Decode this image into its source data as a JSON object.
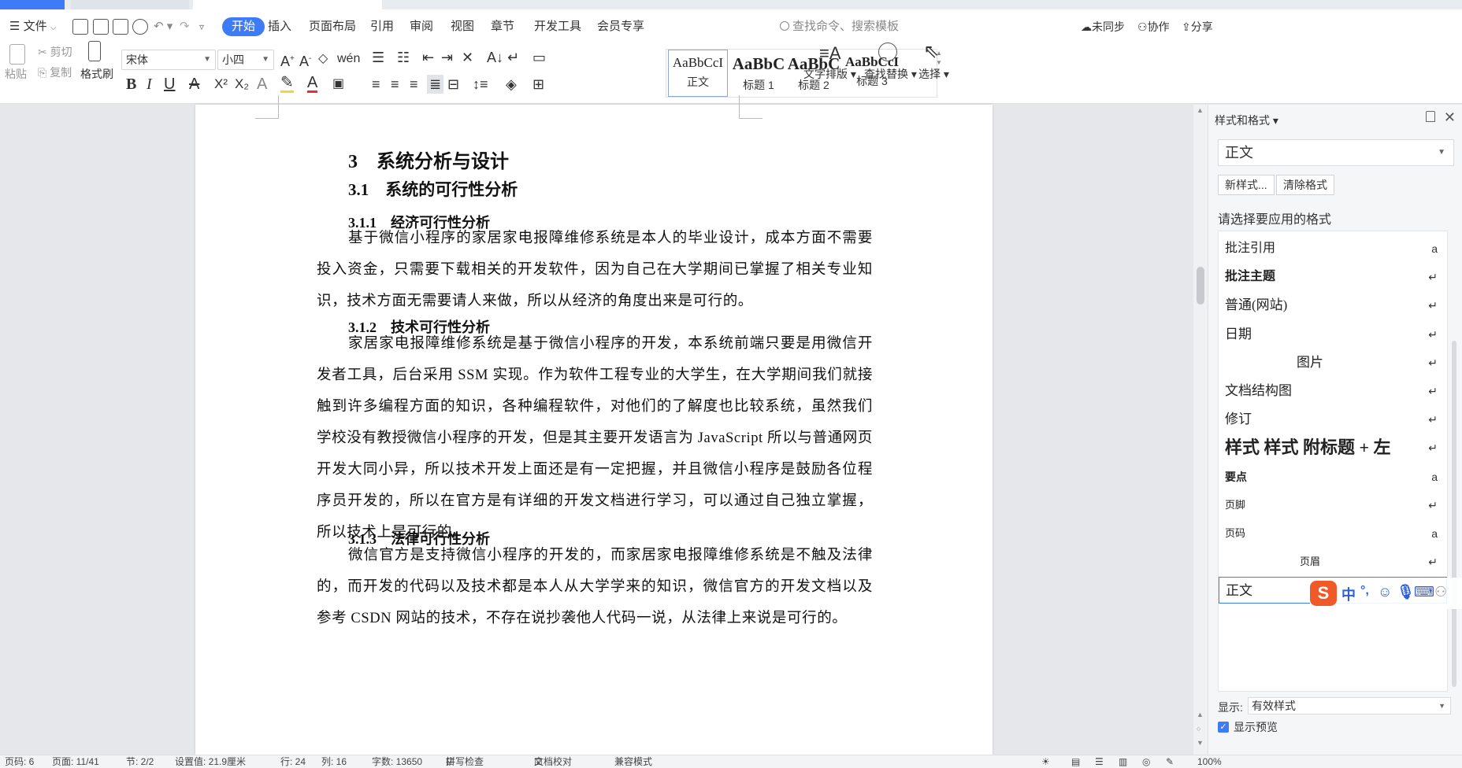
{
  "menu": {
    "file_label": "文件",
    "tabs": [
      {
        "label": "开始",
        "active": true
      },
      {
        "label": "插入"
      },
      {
        "label": "页面布局"
      },
      {
        "label": "引用"
      },
      {
        "label": "审阅"
      },
      {
        "label": "视图"
      },
      {
        "label": "章节"
      },
      {
        "label": "开发工具"
      },
      {
        "label": "会员专享"
      }
    ],
    "search_placeholder": "查找命令、搜索模板",
    "right": {
      "sync": "未同步",
      "collab": "协作",
      "share": "分享"
    }
  },
  "ribbon": {
    "paste": "粘贴",
    "cut": "剪切",
    "copy": "复制",
    "format_painter": "格式刷",
    "font_name": "宋体",
    "font_size": "小四",
    "styles": [
      {
        "preview": "AaBbCcI",
        "name": "正文"
      },
      {
        "preview": "AaBbC",
        "name": "标题 1"
      },
      {
        "preview": "AaBbC",
        "name": "标题 2"
      },
      {
        "preview": "AaBbCcI",
        "name": "标题 3"
      }
    ],
    "text_layout": "文字排版",
    "find_replace": "查找替换",
    "select": "选择"
  },
  "document": {
    "h1": "3　系统分析与设计",
    "h2": "3.1　系统的可行性分析",
    "sections": [
      {
        "heading": "3.1.1　经济可行性分析",
        "body": "基于微信小程序的家居家电报障维修系统是本人的毕业设计，成本方面不需要投入资金，只需要下载相关的开发软件，因为自己在大学期间已掌握了相关专业知识，技术方面无需要请人来做，所以从经济的角度出来是可行的。"
      },
      {
        "heading": "3.1.2　技术可行性分析",
        "body": "家居家电报障维修系统是基于微信小程序的开发，本系统前端只要是用微信开发者工具，后台采用 SSM 实现。作为软件工程专业的大学生，在大学期间我们就接触到许多编程方面的知识，各种编程软件，对他们的了解度也比较系统，虽然我们学校没有教授微信小程序的开发，但是其主要开发语言为 JavaScript 所以与普通网页开发大同小异，所以技术开发上面还是有一定把握，并且微信小程序是鼓励各位程序员开发的，所以在官方是有详细的开发文档进行学习，可以通过自己独立掌握，所以技术上是可行的。"
      },
      {
        "heading": "3.1.3　法律可行性分析",
        "body": "微信官方是支持微信小程序的开发的，而家居家电报障维修系统是不触及法律的，而开发的代码以及技术都是本人从大学学来的知识，微信官方的开发文档以及参考 CSDN 网站的技术，不存在说抄袭他人代码一说，从法律上来说是可行的。"
      }
    ]
  },
  "panel": {
    "title": "样式和格式",
    "current_style": "正文",
    "new_style": "新样式...",
    "clear_format": "清除格式",
    "choose_label": "请选择要应用的格式",
    "styles": [
      {
        "label": "批注引用",
        "mark": "a",
        "weight": "normal",
        "size": "16px",
        "font": "sans"
      },
      {
        "label": "批注主题",
        "mark": "↵",
        "weight": "bold",
        "size": "16px",
        "font": "sans"
      },
      {
        "label": "普通(网站)",
        "mark": "↵",
        "weight": "normal",
        "size": "17px",
        "font": "serif"
      },
      {
        "label": "日期",
        "mark": "↵",
        "weight": "normal",
        "size": "17px",
        "font": "serif"
      },
      {
        "label": "图片",
        "mark": "↵",
        "weight": "normal",
        "size": "17px",
        "font": "serif",
        "center": true
      },
      {
        "label": "文档结构图",
        "mark": "↵",
        "weight": "normal",
        "size": "17px",
        "font": "serif"
      },
      {
        "label": "修订",
        "mark": "↵",
        "weight": "normal",
        "size": "17px",
        "font": "serif"
      },
      {
        "label": "样式 样式 附标题 + 左",
        "mark": "↵",
        "weight": "bold",
        "size": "22px",
        "font": "serif"
      },
      {
        "label": "要点",
        "mark": "a",
        "weight": "bold",
        "size": "14px",
        "font": "sans"
      },
      {
        "label": "页脚",
        "mark": "↵",
        "weight": "normal",
        "size": "13px",
        "font": "sans"
      },
      {
        "label": "页码",
        "mark": "a",
        "weight": "normal",
        "size": "13px",
        "font": "sans"
      },
      {
        "label": "页眉",
        "mark": "↵",
        "weight": "normal",
        "size": "13px",
        "font": "sans",
        "center": true
      },
      {
        "label": "正文",
        "mark": "↵",
        "weight": "normal",
        "size": "17px",
        "font": "serif",
        "selected": true
      }
    ],
    "show_label": "显示:",
    "show_value": "有效样式",
    "preview_label": "显示预览"
  },
  "ime": {
    "lang": "中",
    "punct": "°,"
  },
  "status": {
    "page": "页码: 6",
    "pages": "页面: 11/41",
    "section": "节: 2/2",
    "setting": "设置值: 21.9厘米",
    "row": "行: 24",
    "col": "列: 16",
    "words": "字数: 13650",
    "spell": "拼写检查",
    "doc_check": "文档校对",
    "compat": "兼容模式",
    "zoom": "100%"
  }
}
